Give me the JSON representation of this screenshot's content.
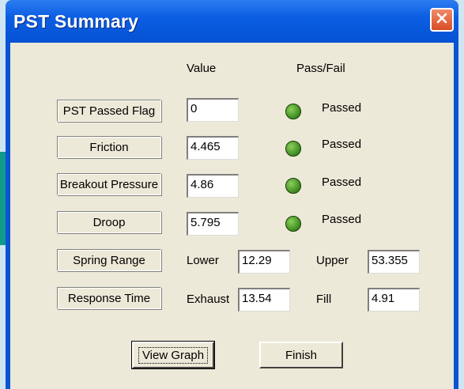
{
  "window": {
    "title": "PST Summary",
    "close_icon": "close-icon"
  },
  "headers": {
    "value": "Value",
    "pass_fail": "Pass/Fail"
  },
  "rows": [
    {
      "label": "PST Passed Flag",
      "value": "0",
      "status": "Passed"
    },
    {
      "label": "Friction",
      "value": "4.465",
      "status": "Passed"
    },
    {
      "label": "Breakout  Pressure",
      "value": "4.86",
      "status": "Passed"
    },
    {
      "label": "Droop",
      "value": "5.795",
      "status": "Passed"
    }
  ],
  "spring_range": {
    "label": "Spring Range",
    "lower_label": "Lower",
    "lower_value": "12.29",
    "upper_label": "Upper",
    "upper_value": "53.355"
  },
  "response_time": {
    "label": "Response Time",
    "exhaust_label": "Exhaust",
    "exhaust_value": "13.54",
    "fill_label": "Fill",
    "fill_value": "4.91"
  },
  "buttons": {
    "view_graph": "View Graph",
    "finish": "Finish"
  },
  "colors": {
    "led": "#4a9c2a",
    "title_bar": "#0b5ee3",
    "close_button": "#e0542e",
    "background": "#ece9d8"
  }
}
